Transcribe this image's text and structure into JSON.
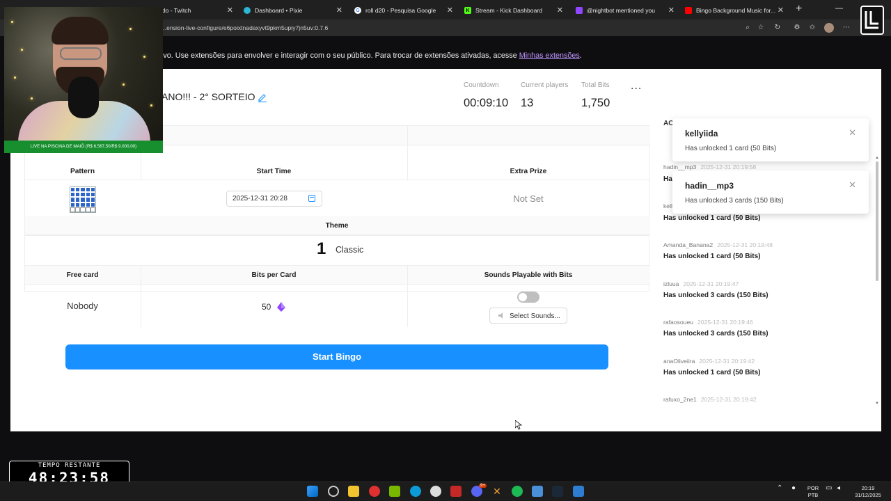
{
  "browser": {
    "tabs": [
      {
        "label": "",
        "color": "#9146ff"
      },
      {
        "label": "...entado - Twitch",
        "color": "#9146ff"
      },
      {
        "label": "Dashboard • Pixie",
        "color": "#2bb6d3"
      },
      {
        "label": "roll d20 - Pesquisa Google",
        "color": "#ffffff"
      },
      {
        "label": "Stream - Kick Dashboard",
        "color": "#53fc18"
      },
      {
        "label": "@nightbot mentioned you",
        "color": "#9146ff"
      },
      {
        "label": "Bingo Background Music for...",
        "color": "#ff0000"
      }
    ],
    "url": "...ension-live-configure/e6poixtnadaxyvt9pkm5upiy7jn5uv:0.7.6"
  },
  "notice": {
    "text": "ivo. Use extensões para envolver e interagir com o seu público. Para trocar de extensões ativadas, acesse ",
    "link": "Minhas extensões",
    "end": "."
  },
  "bingo": {
    "title": "ANO!!! - 2° SORTEIO",
    "stats": {
      "countdown_label": "Countdown",
      "countdown_value": "00:09:10",
      "players_label": "Current players",
      "players_value": "13",
      "bits_label": "Total Bits",
      "bits_value": "1,750"
    },
    "more": "...",
    "headers": {
      "pattern": "Pattern",
      "start_time": "Start Time",
      "extra_prize": "Extra Prize",
      "theme": "Theme",
      "free_card": "Free card",
      "bits_per_card": "Bits per Card",
      "sounds": "Sounds Playable with Bits"
    },
    "start_time": "2025-12-31 20:28",
    "extra_prize": "Not Set",
    "theme_number": "1",
    "theme_name": "Classic",
    "free_card": "Nobody",
    "bits_per_card": "50",
    "sounds_enabled": false,
    "select_sounds": "Select Sounds...",
    "start_button": "Start Bingo",
    "accent_color": "#1890ff"
  },
  "activity": {
    "title": "AC",
    "items": [
      {
        "user": "hadin__mp3",
        "time": "2025-12-31 20:19:58",
        "msg": "Ha"
      },
      {
        "user": "kell",
        "time": "",
        "msg": "Has unlocked 1 card (50 Bits)"
      },
      {
        "user": "Amanda_Banana2",
        "time": "2025-12-31 20:19:48",
        "msg": "Has unlocked 1 card (50 Bits)"
      },
      {
        "user": "izluua",
        "time": "2025-12-31 20:19:47",
        "msg": "Has unlocked 3 cards (150 Bits)"
      },
      {
        "user": "rafaosoueu",
        "time": "2025-12-31 20:19:46",
        "msg": "Has unlocked 3 cards (150 Bits)"
      },
      {
        "user": "anaOliveiira",
        "time": "2025-12-31 20:19:42",
        "msg": "Has unlocked 1 card (50 Bits)"
      },
      {
        "user": "rafuxo_2ne1",
        "time": "2025-12-31 20:19:42",
        "msg": ""
      }
    ]
  },
  "toasts": [
    {
      "title": "kellyiida",
      "msg": "Has unlocked 1 card (50 Bits)"
    },
    {
      "title": "hadin__mp3",
      "msg": "Has unlocked 3 cards (150 Bits)"
    }
  ],
  "overlay": {
    "cam_caption": "LIVE NA PISCINA DE MAIÔ (R$ 6.567,50/R$ 9.000,00)",
    "timer_label": "TEMPO RESTANTE",
    "timer_value": "48:23:58"
  },
  "taskbar": {
    "lang_top": "POR",
    "lang_bottom": "PTB",
    "time": "20:19",
    "date": "31/12/2025",
    "badge": "9+"
  }
}
